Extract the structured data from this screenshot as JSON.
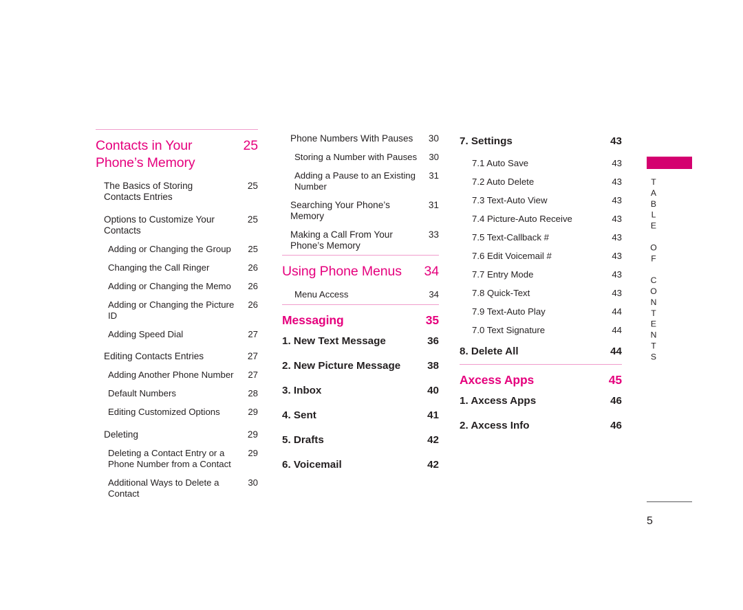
{
  "page": {
    "folio": "5",
    "tab_label": "TABLE OF CONTENTS",
    "accent_color": "#e5007d",
    "tab_swatch_color": "#d4006f",
    "rule_color": "#f09ccb"
  },
  "columns": [
    {
      "name": "left",
      "blocks": [
        {
          "type": "section",
          "rule_above": true,
          "heading": {
            "title": "Contacts in Your Phone’s Memory",
            "page": "25",
            "style": "light"
          },
          "entries": [
            {
              "text": "The Basics of Storing Contacts Entries",
              "page": "25",
              "level": 0,
              "wrap": true,
              "gap": true
            },
            {
              "text": "Options to Customize Your Contacts",
              "page": "25",
              "level": 0,
              "wrap": true,
              "gap": true
            },
            {
              "text": "Adding or Changing the Group",
              "page": "25",
              "level": 1
            },
            {
              "text": "Changing the Call Ringer",
              "page": "26",
              "level": 1
            },
            {
              "text": "Adding or Changing the Memo",
              "page": "26",
              "level": 1
            },
            {
              "text": "Adding or Changing the Picture ID",
              "page": "26",
              "level": 1
            },
            {
              "text": "Adding Speed Dial",
              "page": "27",
              "level": 1
            },
            {
              "text": "Editing Contacts Entries",
              "page": "27",
              "level": 0,
              "gap": true
            },
            {
              "text": "Adding Another Phone Number",
              "page": "27",
              "level": 1
            },
            {
              "text": "Default Numbers",
              "page": "28",
              "level": 1
            },
            {
              "text": "Editing Customized Options",
              "page": "29",
              "level": 1
            },
            {
              "text": "Deleting",
              "page": "29",
              "level": 0,
              "gap": true
            },
            {
              "text": "Deleting a Contact Entry or a Phone Number from a Contact",
              "page": "29",
              "level": 1,
              "wrap": true
            },
            {
              "text": "Additional Ways to Delete a Contact",
              "page": "30",
              "level": 1
            }
          ]
        }
      ]
    },
    {
      "name": "mid",
      "blocks": [
        {
          "type": "plain",
          "rule_above": false,
          "entries": [
            {
              "text": "Phone Numbers With Pauses",
              "page": "30",
              "level": 0
            },
            {
              "text": "Storing a Number with Pauses",
              "page": "30",
              "level": 1
            },
            {
              "text": "Adding a Pause to an Existing Number",
              "page": "31",
              "level": 1,
              "wrap": true
            },
            {
              "text": "Searching Your Phone’s Memory",
              "page": "31",
              "level": 0
            },
            {
              "text": "Making a Call From Your Phone’s Memory",
              "page": "33",
              "level": 0,
              "wrap": true
            }
          ]
        },
        {
          "type": "section",
          "rule_above": true,
          "heading": {
            "title": "Using Phone Menus",
            "page": "34",
            "style": "light"
          },
          "entries": [
            {
              "text": "Menu Access",
              "page": "34",
              "level": 1,
              "gap": true
            }
          ]
        },
        {
          "type": "section",
          "rule_above": true,
          "heading": {
            "title": "Messaging",
            "page": "35",
            "style": "bold"
          },
          "entries": [
            {
              "text": "1. New Text Message",
              "page": "36",
              "level": 1,
              "bold": true
            },
            {
              "text": "2. New Picture Message",
              "page": "38",
              "level": 1,
              "bold": true
            },
            {
              "text": "3. Inbox",
              "page": "40",
              "level": 1,
              "bold": true
            },
            {
              "text": "4. Sent",
              "page": "41",
              "level": 1,
              "bold": true
            },
            {
              "text": "5. Drafts",
              "page": "42",
              "level": 1,
              "bold": true
            },
            {
              "text": "6. Voicemail",
              "page": "42",
              "level": 1,
              "bold": true
            }
          ]
        }
      ]
    },
    {
      "name": "right",
      "blocks": [
        {
          "type": "plain",
          "rule_above": false,
          "entries": [
            {
              "text": "7. Settings",
              "page": "43",
              "level": 0,
              "bold": true
            },
            {
              "text": "7.1 Auto Save",
              "page": "43",
              "level": 1
            },
            {
              "text": "7.2 Auto Delete",
              "page": "43",
              "level": 1
            },
            {
              "text": "7.3 Text-Auto View",
              "page": "43",
              "level": 1
            },
            {
              "text": "7.4 Picture-Auto Receive",
              "page": "43",
              "level": 1
            },
            {
              "text": "7.5 Text-Callback #",
              "page": "43",
              "level": 1
            },
            {
              "text": "7.6 Edit Voicemail #",
              "page": "43",
              "level": 1
            },
            {
              "text": "7.7 Entry Mode",
              "page": "43",
              "level": 1
            },
            {
              "text": "7.8 Quick-Text",
              "page": "43",
              "level": 1
            },
            {
              "text": "7.9 Text-Auto Play",
              "page": "44",
              "level": 1
            },
            {
              "text": "7.0 Text Signature",
              "page": "44",
              "level": 1
            },
            {
              "text": "8. Delete All",
              "page": "44",
              "level": 0,
              "bold": true
            }
          ]
        },
        {
          "type": "section",
          "rule_above": true,
          "heading": {
            "title": "Axcess Apps",
            "page": "45",
            "style": "bold"
          },
          "entries": [
            {
              "text": "1. Axcess Apps",
              "page": "46",
              "level": 1,
              "bold": true
            },
            {
              "text": "2. Axcess Info",
              "page": "46",
              "level": 1,
              "bold": true
            }
          ]
        }
      ]
    }
  ]
}
